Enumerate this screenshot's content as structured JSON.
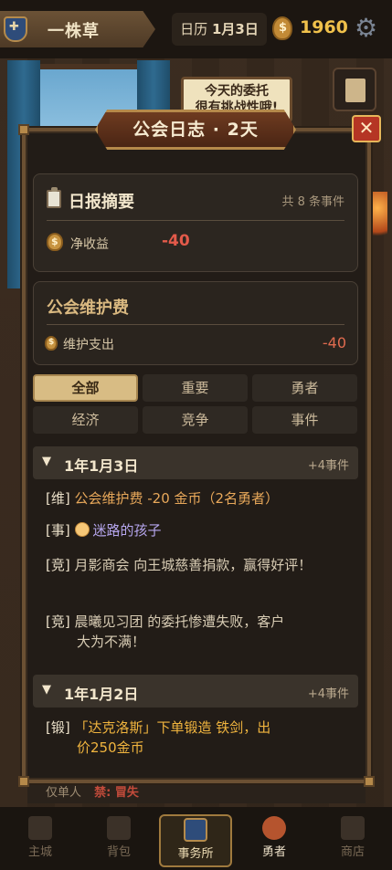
{
  "topbar": {
    "guild_name": "一株草",
    "calendar_label": "日历",
    "date": "1月3日",
    "gold": "1960"
  },
  "scene": {
    "sign_line1": "今天的委托",
    "sign_line2": "很有挑战性哦!"
  },
  "modal": {
    "title": "公会日志 · 2天",
    "close_label": "✕",
    "summary": {
      "title": "日报摘要",
      "event_count": "共 8 条事件",
      "net_label": "净收益",
      "net_value": "-40"
    },
    "upkeep": {
      "title": "公会维护费",
      "label": "维护支出",
      "value": "-40"
    },
    "filters": [
      "全部",
      "重要",
      "勇者",
      "经济",
      "竞争",
      "事件"
    ],
    "active_filter": "全部",
    "days": [
      {
        "title": "1年1月3日",
        "count": "+4事件",
        "entries": [
          {
            "tag": "[维]",
            "text": "公会维护费 -20 金币（2名勇者）",
            "color": "#e8a85a"
          },
          {
            "tag": "[事]",
            "text": "迷路的孩子",
            "color": "#b6a6ee",
            "icon": "child-icon"
          },
          {
            "tag": "[竞]",
            "text": "月影商会 向王城慈善捐款，赢得好评！",
            "color": "#d8ccb4"
          },
          {
            "tag": "[竞]",
            "text": "晨曦见习团 的委托惨遭失败，客户",
            "text2": "大为不满！",
            "color": "#d8ccb4"
          }
        ]
      },
      {
        "title": "1年1月2日",
        "count": "+4事件",
        "entries": [
          {
            "tag": "[锻]",
            "text": "「达克洛斯」下单锻造 铁剑，出",
            "text2": "价250金币",
            "color": "#f0b43e"
          }
        ]
      }
    ]
  },
  "behind_strip": {
    "left": "仅单人",
    "right": "禁: 冒失"
  },
  "bottomnav": {
    "items": [
      "主城",
      "背包",
      "事务所",
      "勇者",
      "商店"
    ],
    "active": "事务所"
  },
  "colors": {
    "accent_gold": "#f0c14b",
    "negative": "#e35a4a",
    "chip_active": "#d8bc84"
  }
}
